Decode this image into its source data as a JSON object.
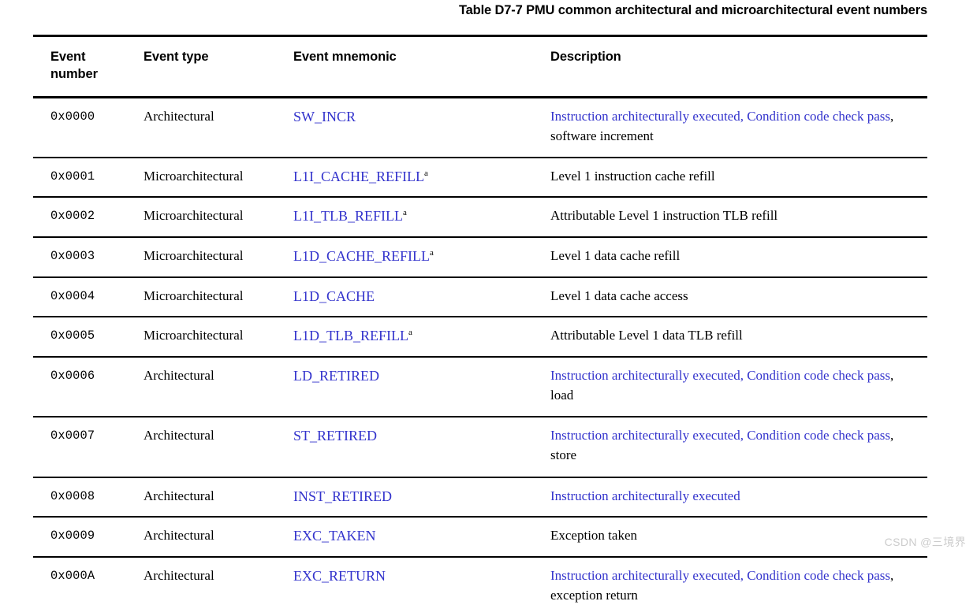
{
  "title": "Table D7-7 PMU common architectural and microarchitectural event numbers",
  "colors": {
    "link_blue": "#3333cc",
    "text_black": "#000000",
    "watermark_gray": "#cccccc",
    "rule_black": "#000000"
  },
  "table": {
    "headers": {
      "event_number": "Event\nnumber",
      "event_number_line1": "Event",
      "event_number_line2": "number",
      "event_type": "Event type",
      "event_mnemonic": "Event mnemonic",
      "description": "Description"
    },
    "rows": [
      {
        "number": "0x0000",
        "type": "Architectural",
        "mnemonic": "SW_INCR",
        "mnemonic_superscript": "",
        "desc_link": "Instruction architecturally executed, Condition code check pass",
        "desc_plain": ", software increment",
        "two_line": true
      },
      {
        "number": "0x0001",
        "type": "Microarchitectural",
        "mnemonic": "L1I_CACHE_REFILL",
        "mnemonic_superscript": "a",
        "desc_link": "",
        "desc_plain": "Level 1 instruction cache refill",
        "two_line": false
      },
      {
        "number": "0x0002",
        "type": "Microarchitectural",
        "mnemonic": "L1I_TLB_REFILL",
        "mnemonic_superscript": "a",
        "desc_link": "",
        "desc_plain": "Attributable Level 1 instruction TLB refill",
        "two_line": false
      },
      {
        "number": "0x0003",
        "type": "Microarchitectural",
        "mnemonic": "L1D_CACHE_REFILL",
        "mnemonic_superscript": "a",
        "desc_link": "",
        "desc_plain": "Level 1 data cache refill",
        "two_line": false
      },
      {
        "number": "0x0004",
        "type": "Microarchitectural",
        "mnemonic": "L1D_CACHE",
        "mnemonic_superscript": "",
        "desc_link": "",
        "desc_plain": "Level 1 data cache access",
        "two_line": false
      },
      {
        "number": "0x0005",
        "type": "Microarchitectural",
        "mnemonic": "L1D_TLB_REFILL",
        "mnemonic_superscript": "a",
        "desc_link": "",
        "desc_plain": "Attributable Level 1 data TLB refill",
        "two_line": false
      },
      {
        "number": "0x0006",
        "type": "Architectural",
        "mnemonic": "LD_RETIRED",
        "mnemonic_superscript": "",
        "desc_link": "Instruction architecturally executed, Condition code check pass",
        "desc_plain": ", load",
        "two_line": true
      },
      {
        "number": "0x0007",
        "type": "Architectural",
        "mnemonic": "ST_RETIRED",
        "mnemonic_superscript": "",
        "desc_link": "Instruction architecturally executed, Condition code check pass",
        "desc_plain": ", store",
        "two_line": true
      },
      {
        "number": "0x0008",
        "type": "Architectural",
        "mnemonic": "INST_RETIRED",
        "mnemonic_superscript": "",
        "desc_link": "Instruction architecturally executed",
        "desc_plain": "",
        "two_line": false
      },
      {
        "number": "0x0009",
        "type": "Architectural",
        "mnemonic": "EXC_TAKEN",
        "mnemonic_superscript": "",
        "desc_link": "",
        "desc_plain": "Exception taken",
        "two_line": false
      },
      {
        "number": "0x000A",
        "type": "Architectural",
        "mnemonic": "EXC_RETURN",
        "mnemonic_superscript": "",
        "desc_link": "Instruction architecturally executed, Condition code check pass",
        "desc_plain": ", exception return",
        "two_line": true
      }
    ]
  },
  "watermark": "CSDN @三境界"
}
